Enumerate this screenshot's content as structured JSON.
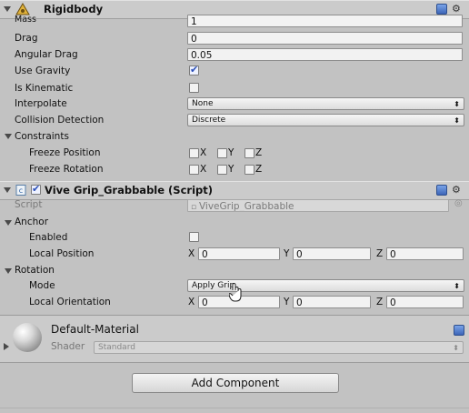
{
  "rigidbody": {
    "title": "Rigidbody",
    "fields": [
      {
        "label": "Mass",
        "value": "1"
      },
      {
        "label": "Drag",
        "value": "0"
      },
      {
        "label": "Angular Drag",
        "value": "0.05"
      }
    ],
    "use_gravity_label": "Use Gravity",
    "use_gravity": true,
    "is_kinematic_label": "Is Kinematic",
    "is_kinematic": false,
    "interpolate_label": "Interpolate",
    "interpolate_value": "None",
    "collision_label": "Collision Detection",
    "collision_value": "Discrete",
    "constraints_label": "Constraints",
    "freeze_position_label": "Freeze Position",
    "freeze_rotation_label": "Freeze Rotation",
    "axes": [
      "X",
      "Y",
      "Z"
    ]
  },
  "grabbable": {
    "title": "Vive Grip_Grabbable (Script)",
    "enabled": true,
    "script_label": "Script",
    "script_value": "ViveGrip_Grabbable",
    "anchor_label": "Anchor",
    "enabled_label": "Enabled",
    "local_position_label": "Local Position",
    "local_position": {
      "x": "0",
      "y": "0",
      "z": "0"
    },
    "rotation_label": "Rotation",
    "mode_label": "Mode",
    "mode_value": "Apply Grip",
    "local_orientation_label": "Local Orientation",
    "local_orientation": {
      "x": "0",
      "y": "0",
      "z": "0"
    }
  },
  "material": {
    "name": "Default-Material",
    "shader_label": "Shader",
    "shader_value": "Standard"
  },
  "add_component_label": "Add Component",
  "colors": {
    "panel": "#c2c2c2",
    "header": "#cbcbcb",
    "checkbox_check": "#2b4fb8"
  }
}
